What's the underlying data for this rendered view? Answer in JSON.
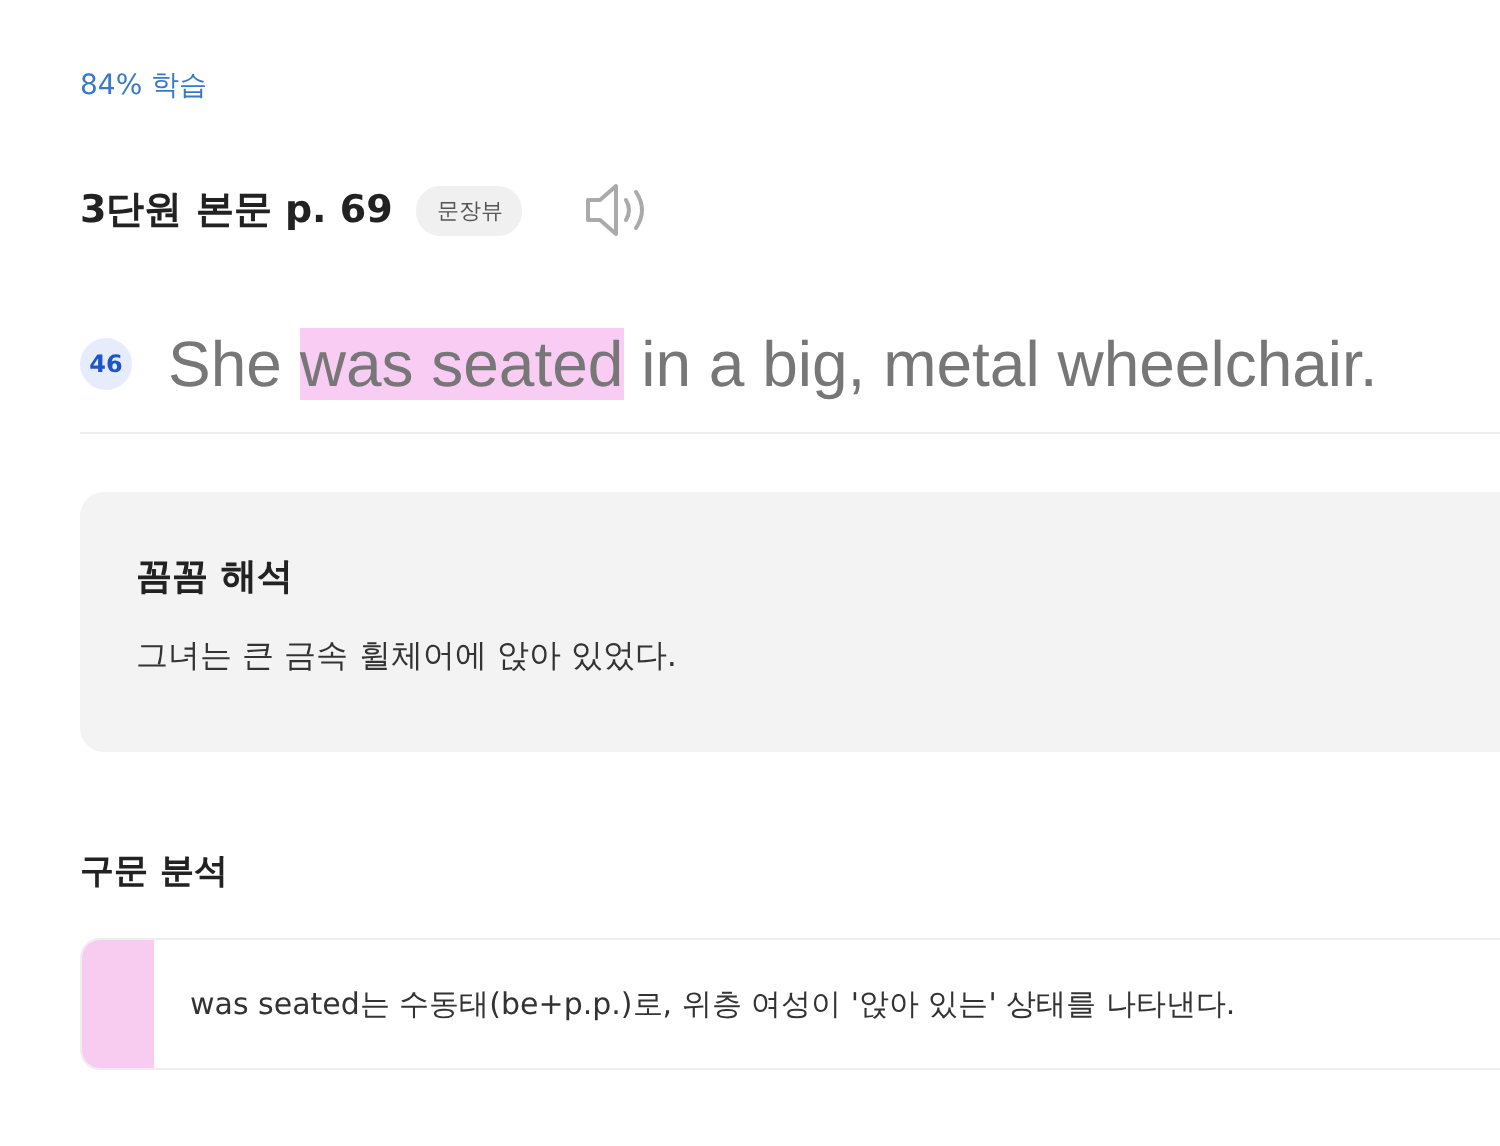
{
  "progress": "84% 학습",
  "header": {
    "title": "3단원 본문 p. 69",
    "badge": "문장뷰"
  },
  "sentence": {
    "number": "46",
    "segments": [
      {
        "text": "She ",
        "highlighted": false
      },
      {
        "text": "was seated",
        "highlighted": true
      },
      {
        "text": " in a big, metal wheelchair.",
        "highlighted": false
      }
    ]
  },
  "translation": {
    "title": "꼼꼼 해석",
    "text": "그녀는 큰 금속 휠체어에 앉아 있었다."
  },
  "analysis": {
    "title": "구문 분석",
    "notes": [
      {
        "text": "was seated는 수동태(be+p.p.)로, 위층 여성이 '앉아 있는' 상태를 나타낸다.",
        "color": "#f8ccf1"
      }
    ]
  }
}
